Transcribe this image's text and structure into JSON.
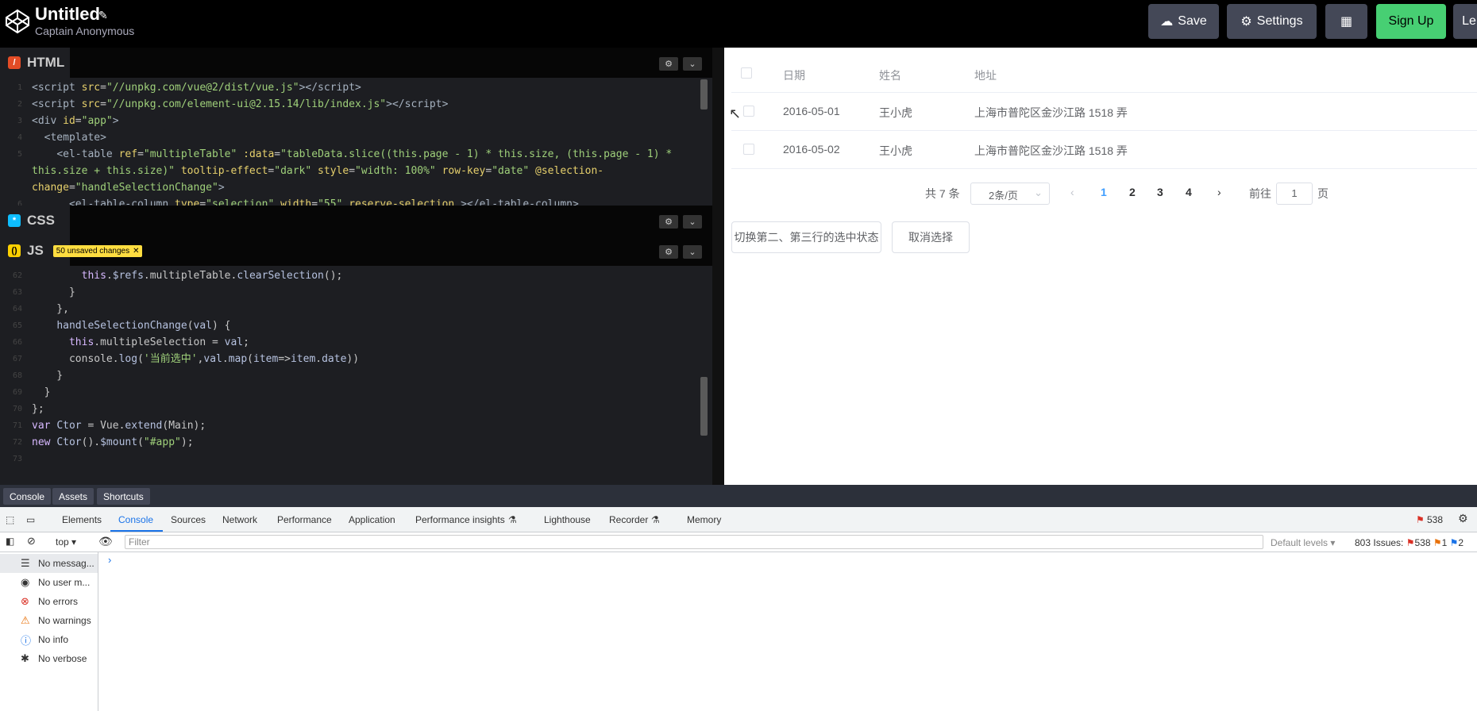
{
  "topbar": {
    "title": "Untitled",
    "author": "Captain Anonymous",
    "save": "Save",
    "settings": "Settings",
    "signup": "Sign Up",
    "login": "Le"
  },
  "html_panel": {
    "label": "HTML",
    "lines": [
      {
        "n": "1",
        "html": "<span class='tag'>&lt;script</span> <span class='attr'>src</span>=<span class='str'>\"//unpkg.com/vue@2/dist/vue.js\"</span><span class='tag'>&gt;&lt;/script&gt;</span>"
      },
      {
        "n": "2",
        "html": "<span class='tag'>&lt;script</span> <span class='attr'>src</span>=<span class='str'>\"//unpkg.com/element-ui@2.15.14/lib/index.js\"</span><span class='tag'>&gt;&lt;/script&gt;</span>"
      },
      {
        "n": "3",
        "html": "<span class='tag'>&lt;div</span> <span class='attr'>id</span>=<span class='str'>\"app\"</span><span class='tag'>&gt;</span>"
      },
      {
        "n": "4",
        "html": "  <span class='tag'>&lt;template&gt;</span>"
      },
      {
        "n": "5",
        "html": "    <span class='tag'>&lt;el-table</span> <span class='attr'>ref</span>=<span class='str'>\"multipleTable\"</span> <span class='attr'>:data</span>=<span class='str'>\"tableData.slice((this.page - 1) * this.size, (this.page - 1) *</span>"
      },
      {
        "n": "",
        "html": "<span class='str'>this.size + this.size)\"</span> <span class='attr'>tooltip-effect</span>=<span class='str'>\"dark\"</span> <span class='attr'>style</span>=<span class='str'>\"width: 100%\"</span> <span class='attr'>row-key</span>=<span class='str'>\"date\"</span> <span class='attr'>@selection-</span>"
      },
      {
        "n": "",
        "html": "<span class='attr'>change</span>=<span class='str'>\"handleSelectionChange\"</span><span class='tag'>&gt;</span>"
      },
      {
        "n": "6",
        "html": "      <span class='tag'>&lt;el-table-column</span> <span class='attr'>type</span>=<span class='str'>\"selection\"</span> <span class='attr'>width</span>=<span class='str'>\"55\"</span> <span class='attr'>reserve-selection</span> <span class='tag'>&gt;&lt;/el-table-column&gt;</span>"
      }
    ]
  },
  "css_panel": {
    "label": "CSS"
  },
  "js_panel": {
    "label": "JS",
    "unsaved": "50 unsaved changes",
    "lines": [
      {
        "n": "62",
        "html": "        <span class='kw'>this</span>.<span class='fn'>$refs</span>.multipleTable.<span class='fn'>clearSelection</span>();"
      },
      {
        "n": "63",
        "html": "      }"
      },
      {
        "n": "64",
        "html": "    },"
      },
      {
        "n": "65",
        "html": "    <span class='fn'>handleSelectionChange</span>(<span class='fn'>val</span>) {"
      },
      {
        "n": "66",
        "html": "      <span class='kw'>this</span>.multipleSelection = <span class='fn'>val</span>;"
      },
      {
        "n": "67",
        "html": "      console.<span class='fn'>log</span>(<span class='str'>'当前选中'</span>,<span class='fn'>val</span>.<span class='fn'>map</span>(<span class='fn'>item</span>=&gt;<span class='fn'>item</span>.<span class='fn'>date</span>))"
      },
      {
        "n": "68",
        "html": "    }"
      },
      {
        "n": "69",
        "html": "  }"
      },
      {
        "n": "70",
        "html": "};"
      },
      {
        "n": "71",
        "html": "<span class='kw'>var</span> <span class='fn'>Ctor</span> = Vue.<span class='fn'>extend</span>(Main);"
      },
      {
        "n": "72",
        "html": "<span class='kw'>new</span> <span class='fn'>Ctor</span>().<span class='fn'>$mount</span>(<span class='str'>\"#app\"</span>);"
      },
      {
        "n": "73",
        "html": ""
      }
    ]
  },
  "table": {
    "headers": [
      "日期",
      "姓名",
      "地址"
    ],
    "rows": [
      {
        "date": "2016-05-01",
        "name": "王小虎",
        "address": "上海市普陀区金沙江路 1518 弄"
      },
      {
        "date": "2016-05-02",
        "name": "王小虎",
        "address": "上海市普陀区金沙江路 1518 弄"
      }
    ]
  },
  "pagination": {
    "total": "共 7 条",
    "size": "2条/页",
    "pages": [
      "1",
      "2",
      "3",
      "4"
    ],
    "goto": "前往",
    "goto_value": "1",
    "page_unit": "页",
    "prev": "‹",
    "next": "›"
  },
  "buttons": {
    "toggle": "切换第二、第三行的选中状态",
    "clear": "取消选择"
  },
  "codepen_tabs": [
    "Console",
    "Assets",
    "Shortcuts"
  ],
  "devtools": {
    "tabs": [
      "Elements",
      "Console",
      "Sources",
      "Network",
      "Performance",
      "Application",
      "Performance insights",
      "Lighthouse",
      "Recorder",
      "Memory"
    ],
    "issues_badge": "538",
    "context": "top",
    "filter_placeholder": "Filter",
    "levels": "Default levels",
    "issues": "803 Issues:",
    "issue_counts": [
      "538",
      "1",
      "2"
    ],
    "sidebar": [
      "No messag...",
      "No user m...",
      "No errors",
      "No warnings",
      "No info",
      "No verbose"
    ]
  },
  "colors": {
    "accent": "#409eff",
    "signup": "#47cf73",
    "topbar": "#000000"
  }
}
